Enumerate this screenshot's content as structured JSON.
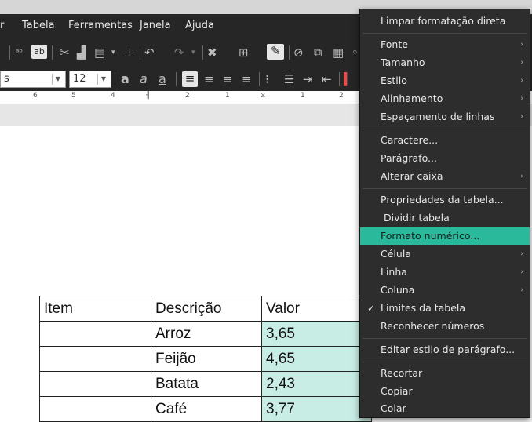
{
  "menubar": {
    "items": [
      "Tabela",
      "Ferramentas",
      "Janela",
      "Ajuda"
    ]
  },
  "toolbar": {
    "font_name_fragment": "s",
    "font_size": "12"
  },
  "ruler": {
    "labels": [
      "6",
      "5",
      "4",
      "2",
      "1",
      "1",
      "2"
    ]
  },
  "table": {
    "headers": [
      "Item",
      "Descrição",
      "Valor"
    ],
    "rows": [
      [
        "",
        "Arroz",
        "3,65"
      ],
      [
        "",
        "Feijão",
        "4,65"
      ],
      [
        "",
        "Batata",
        "2,43"
      ],
      [
        "",
        "Café",
        "3,77"
      ]
    ]
  },
  "context_menu": {
    "items": [
      {
        "label": "Limpar formatação direta"
      },
      {
        "label": "Fonte",
        "submenu": true
      },
      {
        "label": "Tamanho",
        "submenu": true
      },
      {
        "label": "Estilo",
        "submenu": true
      },
      {
        "label": "Alinhamento",
        "submenu": true
      },
      {
        "label": "Espaçamento de linhas",
        "submenu": true
      },
      {
        "label": "Caractere..."
      },
      {
        "label": "Parágrafo..."
      },
      {
        "label": "Alterar caixa",
        "submenu": true
      },
      {
        "label": "Propriedades da tabela..."
      },
      {
        "label": "Dividir tabela"
      },
      {
        "label": "Formato numérico...",
        "highlighted": true
      },
      {
        "label": "Célula",
        "submenu": true
      },
      {
        "label": "Linha",
        "submenu": true
      },
      {
        "label": "Coluna",
        "submenu": true
      },
      {
        "label": "Limites da tabela",
        "checked": true
      },
      {
        "label": "Reconhecer números"
      },
      {
        "label": "Editar estilo de parágrafo..."
      },
      {
        "label": "Recortar"
      },
      {
        "label": "Copiar"
      },
      {
        "label": "Colar"
      }
    ]
  },
  "colors": {
    "highlight": "#2bb99c",
    "selected_cell": "#c8ede5",
    "menu_bg": "#2d2d2d",
    "toolbar_bg": "#262626"
  }
}
